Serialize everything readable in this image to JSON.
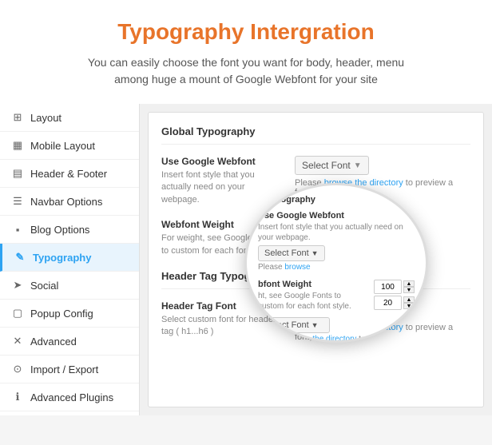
{
  "header": {
    "title": "Typography Intergration",
    "subtitle_line1": "You can easily choose the font you want for body, header, menu",
    "subtitle_line2": "among huge a mount of Google Webfont for your site"
  },
  "sidebar": {
    "items": [
      {
        "id": "layout",
        "label": "Layout",
        "icon": "⊞"
      },
      {
        "id": "mobile-layout",
        "label": "Mobile Layout",
        "icon": "📱"
      },
      {
        "id": "header-footer",
        "label": "Header & Footer",
        "icon": "▤"
      },
      {
        "id": "navbar-options",
        "label": "Navbar Options",
        "icon": "☰"
      },
      {
        "id": "blog-options",
        "label": "Blog Options",
        "icon": "📰"
      },
      {
        "id": "typography",
        "label": "Typography",
        "icon": "✏️",
        "active": true
      },
      {
        "id": "social",
        "label": "Social",
        "icon": "➤"
      },
      {
        "id": "popup-config",
        "label": "Popup Config",
        "icon": "🗔"
      },
      {
        "id": "advanced",
        "label": "Advanced",
        "icon": "✕"
      },
      {
        "id": "import-export",
        "label": "Import / Export",
        "icon": "⊙"
      },
      {
        "id": "advanced-plugins",
        "label": "Advanced Plugins",
        "icon": "ℹ"
      }
    ]
  },
  "main": {
    "section_title": "Global Typography",
    "rows": [
      {
        "id": "use-google-webfont",
        "title": "Use Google Webfont",
        "desc": "Insert font style that you actually need on your webpage.",
        "control_type": "select",
        "select_label": "Select Font",
        "browse_text": "Please ",
        "browse_link": "browse the directory",
        "browse_rest": " to preview a font, then sele"
      },
      {
        "id": "webfont-weight",
        "title": "Webfont Weight",
        "desc": "For weight, see Google Fonts to custom for each font style.",
        "control_type": "number",
        "value1": "100",
        "value2": "20"
      }
    ],
    "header_tag_section": "Header Tag Typography",
    "header_tag_row": {
      "title": "Header Tag Font",
      "desc": "Select custom font for header tag ( h1...h6 )",
      "select_label": "Select Font",
      "browse_text": "Please ",
      "browse_link": "browse the directory",
      "browse_rest": " to preview a font, then sele"
    }
  },
  "magnify": {
    "section_title": "n Typography",
    "webfont_row": {
      "title": "Use Google Webfont",
      "desc": "Insert font style that you actually need on your webpage.",
      "select_label": "Select Font",
      "browse_text": "Please ",
      "browse_link": "browse"
    },
    "weight_row": {
      "title": "bfont Weight",
      "desc": "ht, see Google Fonts to custom for each font style.",
      "value1": "100",
      "value2": "20",
      "select_label": "Select Font",
      "browse_text": "Please ",
      "browse_link": "browse the directory",
      "browse_rest": " to preview a font, then sele"
    }
  },
  "colors": {
    "accent": "#e8742a",
    "link": "#2ea3f2",
    "active_border": "#2ea3f2"
  }
}
